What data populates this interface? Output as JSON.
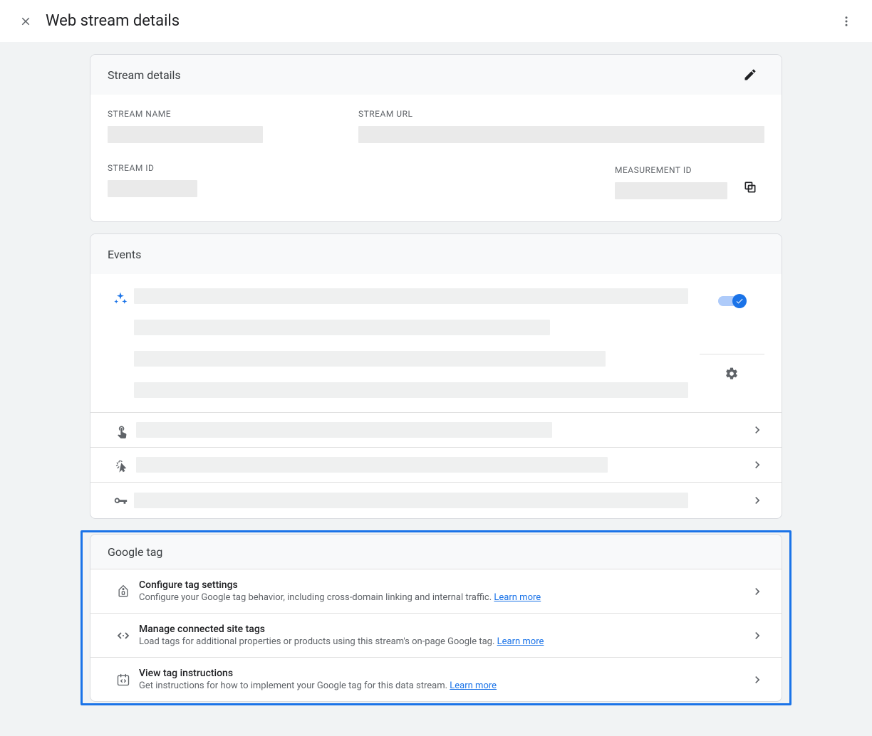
{
  "header": {
    "title": "Web stream details"
  },
  "stream_details": {
    "card_title": "Stream details",
    "labels": {
      "stream_name": "STREAM NAME",
      "stream_url": "STREAM URL",
      "stream_id": "STREAM ID",
      "measurement_id": "MEASUREMENT ID"
    }
  },
  "events": {
    "card_title": "Events",
    "enhanced_toggle_on": true
  },
  "google_tag": {
    "card_title": "Google tag",
    "rows": [
      {
        "title": "Configure tag settings",
        "sub": "Configure your Google tag behavior, including cross-domain linking and internal traffic. ",
        "learn": "Learn more"
      },
      {
        "title": "Manage connected site tags",
        "sub": "Load tags for additional properties or products using this stream's on-page Google tag. ",
        "learn": "Learn more"
      },
      {
        "title": "View tag instructions",
        "sub": "Get instructions for how to implement your Google tag for this data stream. ",
        "learn": "Learn more"
      }
    ]
  }
}
